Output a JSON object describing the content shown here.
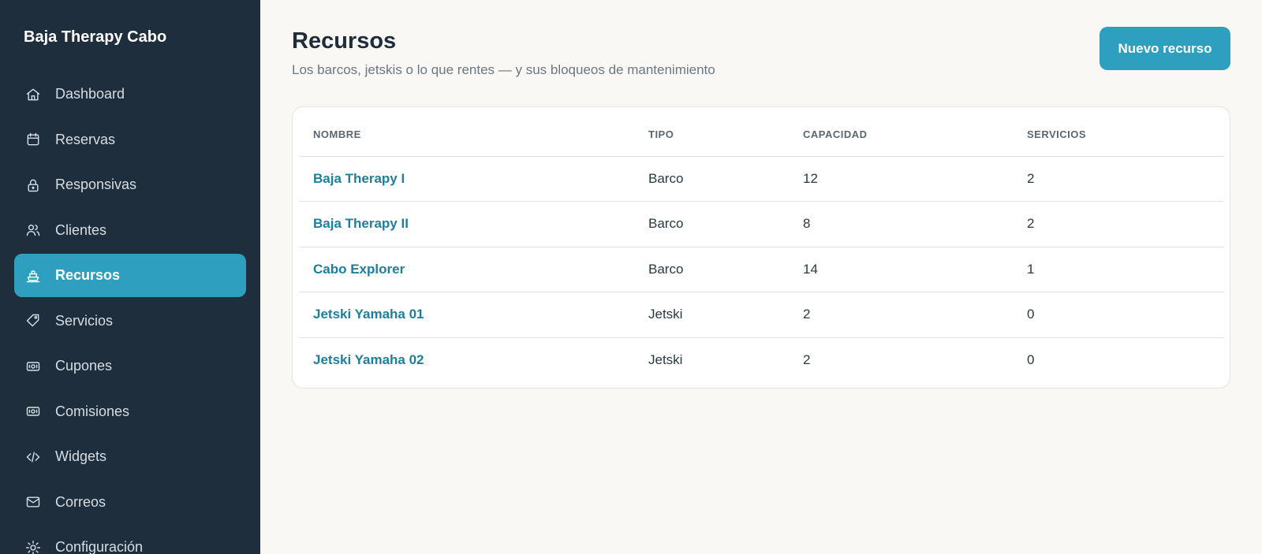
{
  "sidebar": {
    "brand": "Baja Therapy Cabo",
    "items": [
      {
        "label": "Dashboard",
        "icon": "home-icon",
        "active": false
      },
      {
        "label": "Reservas",
        "icon": "calendar-icon",
        "active": false
      },
      {
        "label": "Responsivas",
        "icon": "lock-icon",
        "active": false
      },
      {
        "label": "Clientes",
        "icon": "users-icon",
        "active": false
      },
      {
        "label": "Recursos",
        "icon": "boat-icon",
        "active": true
      },
      {
        "label": "Servicios",
        "icon": "tag-icon",
        "active": false
      },
      {
        "label": "Cupones",
        "icon": "banknote-icon",
        "active": false
      },
      {
        "label": "Comisiones",
        "icon": "banknote-icon",
        "active": false
      },
      {
        "label": "Widgets",
        "icon": "code-icon",
        "active": false
      },
      {
        "label": "Correos",
        "icon": "mail-icon",
        "active": false
      },
      {
        "label": "Configuración",
        "icon": "sun-icon",
        "active": false
      }
    ]
  },
  "header": {
    "title": "Recursos",
    "subtitle": "Los barcos, jetskis o lo que rentes — y sus bloqueos de mantenimiento",
    "new_button": "Nuevo recurso"
  },
  "table": {
    "columns": [
      "NOMBRE",
      "TIPO",
      "CAPACIDAD",
      "SERVICIOS"
    ],
    "rows": [
      {
        "nombre": "Baja Therapy I",
        "tipo": "Barco",
        "capacidad": "12",
        "servicios": "2"
      },
      {
        "nombre": "Baja Therapy II",
        "tipo": "Barco",
        "capacidad": "8",
        "servicios": "2"
      },
      {
        "nombre": "Cabo Explorer",
        "tipo": "Barco",
        "capacidad": "14",
        "servicios": "1"
      },
      {
        "nombre": "Jetski Yamaha 01",
        "tipo": "Jetski",
        "capacidad": "2",
        "servicios": "0"
      },
      {
        "nombre": "Jetski Yamaha 02",
        "tipo": "Jetski",
        "capacidad": "2",
        "servicios": "0"
      }
    ]
  },
  "colors": {
    "sidebar_bg": "#1e2e3d",
    "accent": "#2e9fbe",
    "link": "#1d7f9c",
    "page_bg": "#f9f8f4"
  }
}
